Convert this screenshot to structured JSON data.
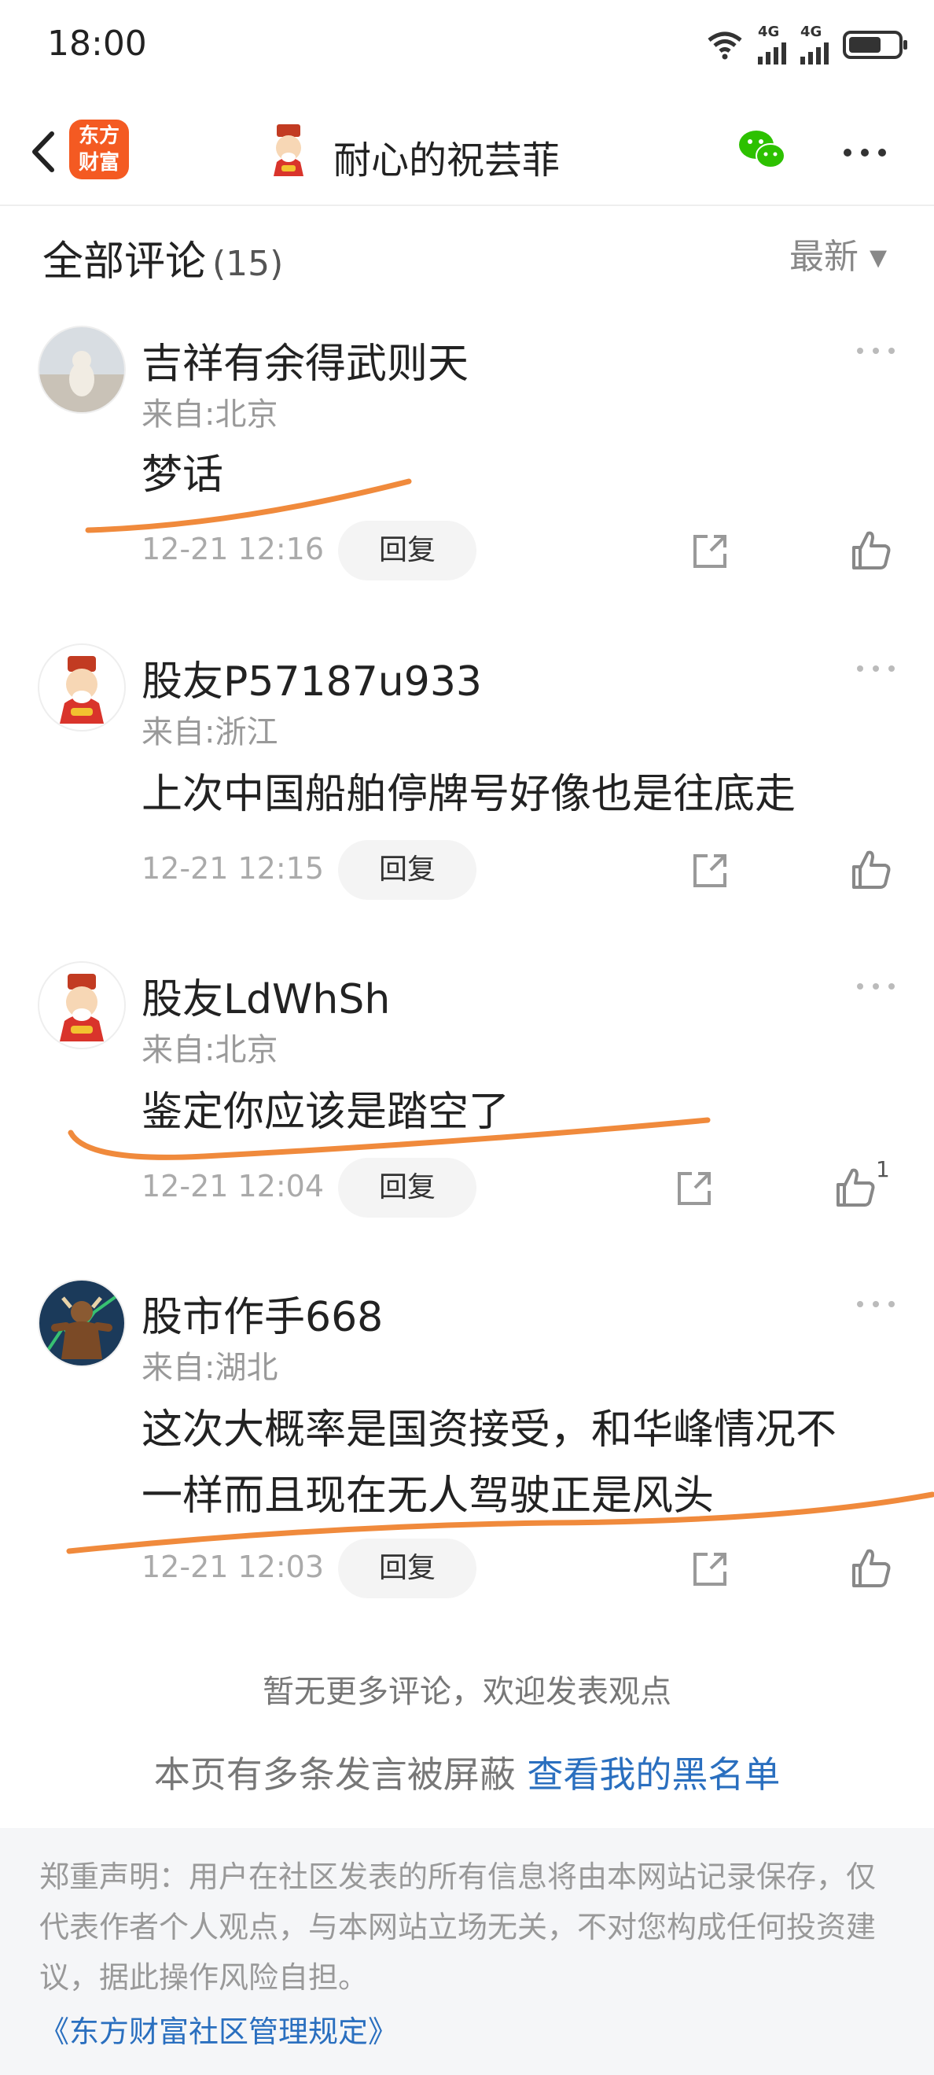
{
  "status_bar": {
    "time": "18:00",
    "net1": "4G",
    "net2": "4G"
  },
  "header": {
    "logo_line1": "东方",
    "logo_line2": "财富",
    "title": "耐心的祝芸菲"
  },
  "section": {
    "title": "全部评论",
    "count": "(15)",
    "sort_label": "最新 ▾"
  },
  "comments": [
    {
      "name": "吉祥有余得武则天",
      "location": "来自:北京",
      "text": "梦话",
      "time": "12-21 12:16",
      "reply": "回复",
      "likes": ""
    },
    {
      "name": "股友P57187u933",
      "location": "来自:浙江",
      "text": "上次中国船舶停牌号好像也是往底走",
      "time": "12-21 12:15",
      "reply": "回复",
      "likes": ""
    },
    {
      "name": "股友LdWhSh",
      "location": "来自:北京",
      "text": "鉴定你应该是踏空了",
      "time": "12-21 12:04",
      "reply": "回复",
      "likes": "1"
    },
    {
      "name": "股市作手668",
      "location": "来自:湖北",
      "text_line1": "这次大概率是国资接受，和华峰情况不",
      "text_line2": "一样而且现在无人驾驶正是风头",
      "time": "12-21 12:03",
      "reply": "回复",
      "likes": ""
    }
  ],
  "no_more": "暂无更多评论，欢迎发表观点",
  "blocked": {
    "text": "本页有多条发言被屏蔽 ",
    "link": "查看我的黑名单"
  },
  "footer": {
    "disclaimer": "郑重声明：用户在社区发表的所有信息将由本网站记录保存，仅代表作者个人观点，与本网站立场无关，不对您构成任何投资建议，据此操作风险自担。",
    "rules_link": "《东方财富社区管理规定》"
  },
  "colors": {
    "accent": "#2a6fbf",
    "brand": "#f45a22",
    "ink": "#f08a3c"
  }
}
